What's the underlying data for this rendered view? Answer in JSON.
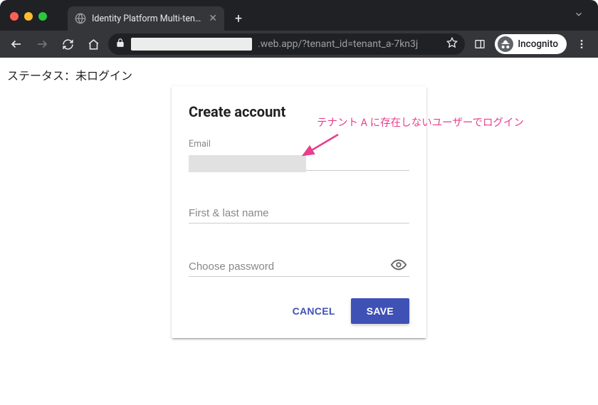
{
  "browser": {
    "tab_title": "Identity Platform Multi-tenant",
    "url_suffix": ".web.app/?tenant_id=tenant_a-7kn3j",
    "incognito_label": "Incognito"
  },
  "page": {
    "status_text": "ステータス：未ログイン"
  },
  "form": {
    "title": "Create account",
    "email_label": "Email",
    "email_value": "",
    "name_placeholder": "First & last name",
    "name_value": "",
    "password_placeholder": "Choose password",
    "password_value": "",
    "cancel_label": "CANCEL",
    "save_label": "SAVE"
  },
  "annotation": {
    "text": "テナント A に存在しないユーザーでログイン"
  }
}
